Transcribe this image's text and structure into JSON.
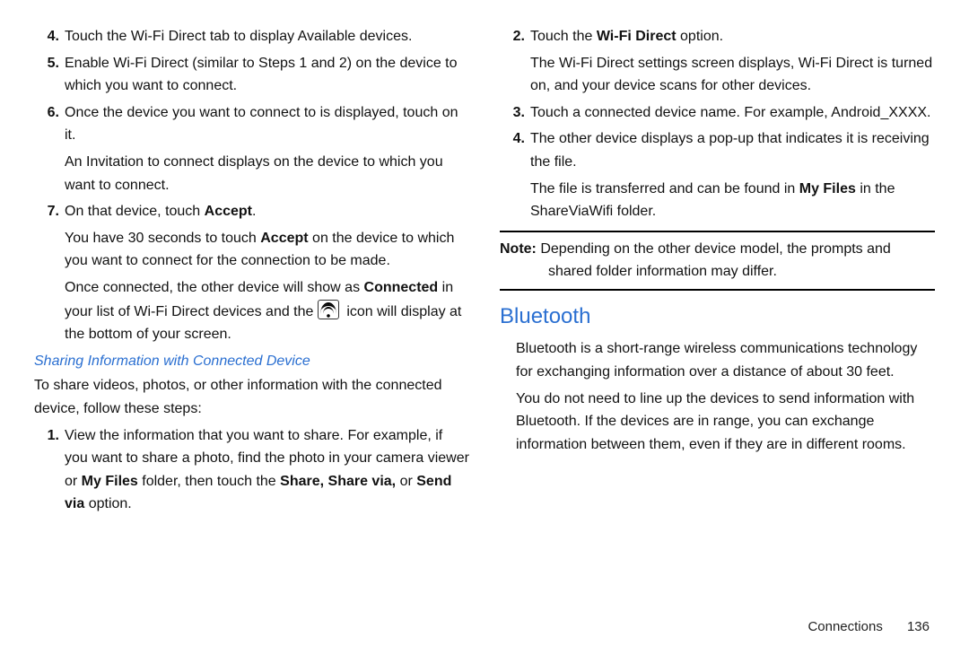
{
  "left": {
    "it4": "Touch the Wi-Fi Direct tab to display Available devices.",
    "it5": "Enable Wi-Fi Direct (similar to Steps 1 and 2) on the device to which you want to connect.",
    "it6": "Once the device you want to connect to is displayed, touch on it.",
    "it6b": "An Invitation to connect displays on the device to which you want to connect.",
    "it7a": "On that device, touch ",
    "it7a_bold": "Accept",
    "it7a_end": ".",
    "it7b_a": "You have 30 seconds to touch ",
    "it7b_bold": "Accept",
    "it7b_b": " on the device to which you want to connect for the connection to be made.",
    "it7c_a": "Once connected, the other device will show as ",
    "it7c_bold": "Connected",
    "it7c_b": " in your list of Wi-Fi Direct devices and the ",
    "it7c_c": " icon will display at the bottom of your screen.",
    "subhead": "Sharing Information with Connected Device",
    "intro": "To share videos, photos, or other information with the connected device, follow these steps:",
    "s1a": "View the information that you want to share. For example, if you want to share a photo, find the photo in your camera viewer or ",
    "s1_bold1": "My Files",
    "s1b": " folder, then touch the ",
    "s1_bold2": "Share, Share via,",
    "s1c": " or ",
    "s1_bold3": "Send via",
    "s1d": " option."
  },
  "right": {
    "s2a": "Touch the ",
    "s2_bold": "Wi-Fi Direct",
    "s2b": " option.",
    "s2c": "The Wi-Fi Direct settings screen displays, Wi-Fi Direct is turned on, and your device scans for other devices.",
    "s3": "Touch a connected device name. For example, Android_XXXX.",
    "s4a": "The other device displays a pop-up that indicates it is receiving the file.",
    "s4b_a": "The file is transferred and can be found in ",
    "s4b_bold": "My Files",
    "s4b_b": " in the ShareViaWifi folder.",
    "note_label": "Note:",
    "note_body": " Depending on the other device model, the prompts and shared folder information may differ.",
    "bt_head": "Bluetooth",
    "bt_p1": "Bluetooth is a short-range wireless communications technology for exchanging information over a distance of about 30 feet.",
    "bt_p2": "You do not need to line up the devices to send information with Bluetooth. If the devices are in range, you can exchange information between them, even if they are in different rooms."
  },
  "footer": {
    "section": "Connections",
    "page": "136"
  },
  "nums": {
    "n4": "4.",
    "n5": "5.",
    "n6": "6.",
    "n7": "7.",
    "n1": "1.",
    "n2": "2.",
    "n3": "3.",
    "n4b": "4."
  }
}
